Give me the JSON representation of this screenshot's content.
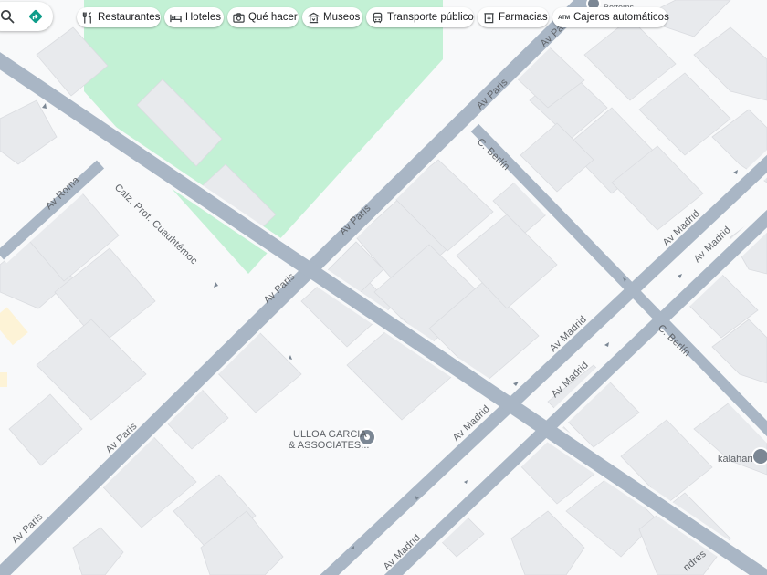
{
  "chips": [
    {
      "label": "Restaurantes",
      "icon": "fork-knife-icon"
    },
    {
      "label": "Hoteles",
      "icon": "bed-icon"
    },
    {
      "label": "Qué hacer",
      "icon": "camera-icon"
    },
    {
      "label": "Museos",
      "icon": "museum-icon"
    },
    {
      "label": "Transporte público",
      "icon": "bus-icon"
    },
    {
      "label": "Farmacias",
      "icon": "pharmacy-icon"
    },
    {
      "label": "Cajeros automáticos",
      "icon": "atm-icon",
      "badge": "ATM"
    }
  ],
  "streets": {
    "av_paris_1": "Av Paris",
    "av_paris_2": "Av Paris",
    "av_paris_3": "Av Paris",
    "av_paris_4": "Av Paris",
    "av_paris_5": "Av Paris",
    "av_roma": "Av Roma",
    "calz_cuauhtemoc": "Calz. Prof. Cuauhtémoc",
    "c_berlin_1": "C. Berlín",
    "c_berlin_2": "C. Berlín",
    "av_madrid_1": "Av Madrid",
    "av_madrid_2": "Av Madrid",
    "av_madrid_3": "Av Madrid",
    "av_madrid_4": "Av Madrid",
    "av_madrid_5": "Av Madrid",
    "av_madrid_6": "Av Madrid",
    "londres": "ndres"
  },
  "places": {
    "ulloa_line1": "ULLOA GARCIA",
    "ulloa_line2": "& ASSOCIATES...",
    "kalahari": "kalahari",
    "top_poi": "Bottoms"
  },
  "colors": {
    "road": "#a9b6c5",
    "road_edge": "#f8f9fa",
    "block": "#f8f9fa",
    "building": "#e8eaed",
    "park": "#c3f1d5",
    "chip_text": "#202124",
    "directions": "#0f9d8a",
    "poi_pin": "#70757a"
  }
}
